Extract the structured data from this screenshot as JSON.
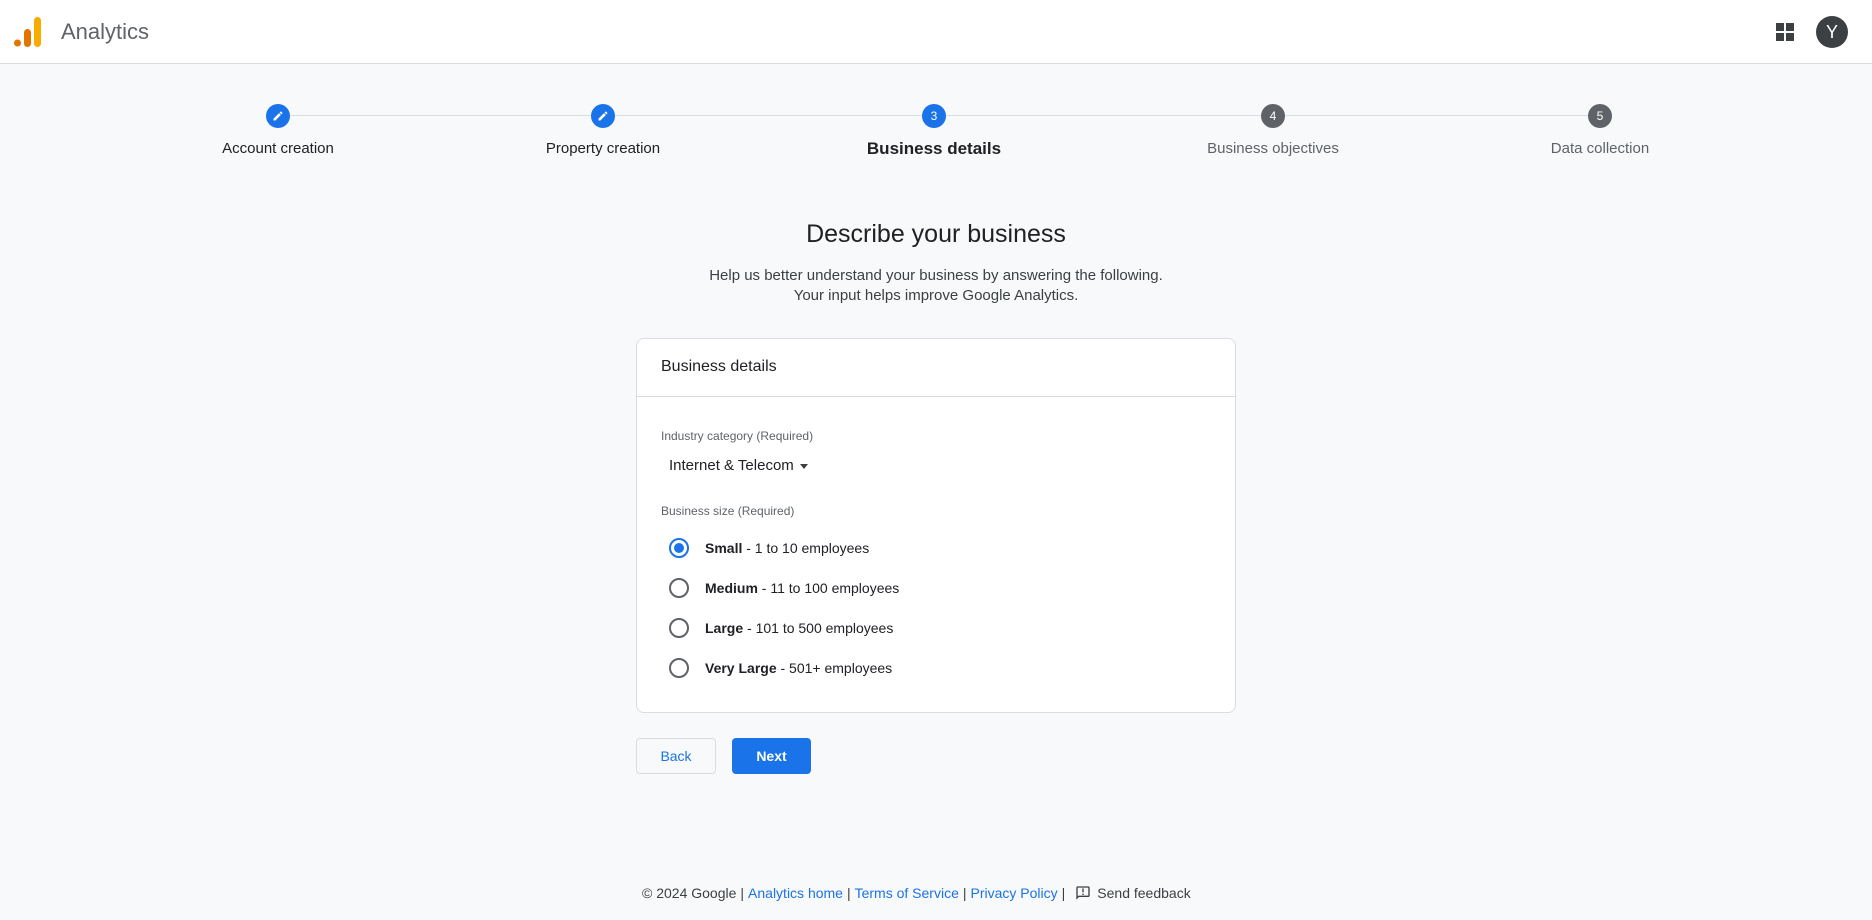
{
  "header": {
    "app_title": "Analytics",
    "apps_icon": "apps-grid-icon",
    "avatar_letter": "Y"
  },
  "stepper": {
    "steps": [
      {
        "label": "Account creation",
        "state": "completed",
        "icon": "pencil-icon"
      },
      {
        "label": "Property creation",
        "state": "completed",
        "icon": "pencil-icon"
      },
      {
        "label": "Business details",
        "state": "current",
        "number": "3"
      },
      {
        "label": "Business objectives",
        "state": "upcoming",
        "number": "4"
      },
      {
        "label": "Data collection",
        "state": "upcoming",
        "number": "5"
      }
    ]
  },
  "main": {
    "heading": "Describe your business",
    "subtext_line1": "Help us better understand your business by answering the following.",
    "subtext_line2": "Your input helps improve Google Analytics."
  },
  "card": {
    "title": "Business details",
    "industry_label": "Industry category (Required)",
    "industry_value": "Internet & Telecom",
    "size_label": "Business size (Required)",
    "size_options": [
      {
        "name": "Small",
        "detail": "- 1 to 10 employees",
        "checked": true
      },
      {
        "name": "Medium",
        "detail": "- 11 to 100 employees",
        "checked": false
      },
      {
        "name": "Large",
        "detail": "- 101 to 500 employees",
        "checked": false
      },
      {
        "name": "Very Large",
        "detail": "- 501+ employees",
        "checked": false
      }
    ]
  },
  "buttons": {
    "back_label": "Back",
    "next_label": "Next"
  },
  "footer": {
    "copyright": "© 2024 Google",
    "analytics_home": "Analytics home",
    "terms": "Terms of Service",
    "privacy": "Privacy Policy",
    "feedback": "Send feedback",
    "separator": "|"
  },
  "colors": {
    "accent": "#1a73e8",
    "logo_orange": "#f9ab00",
    "logo_dark_orange": "#e37400"
  }
}
